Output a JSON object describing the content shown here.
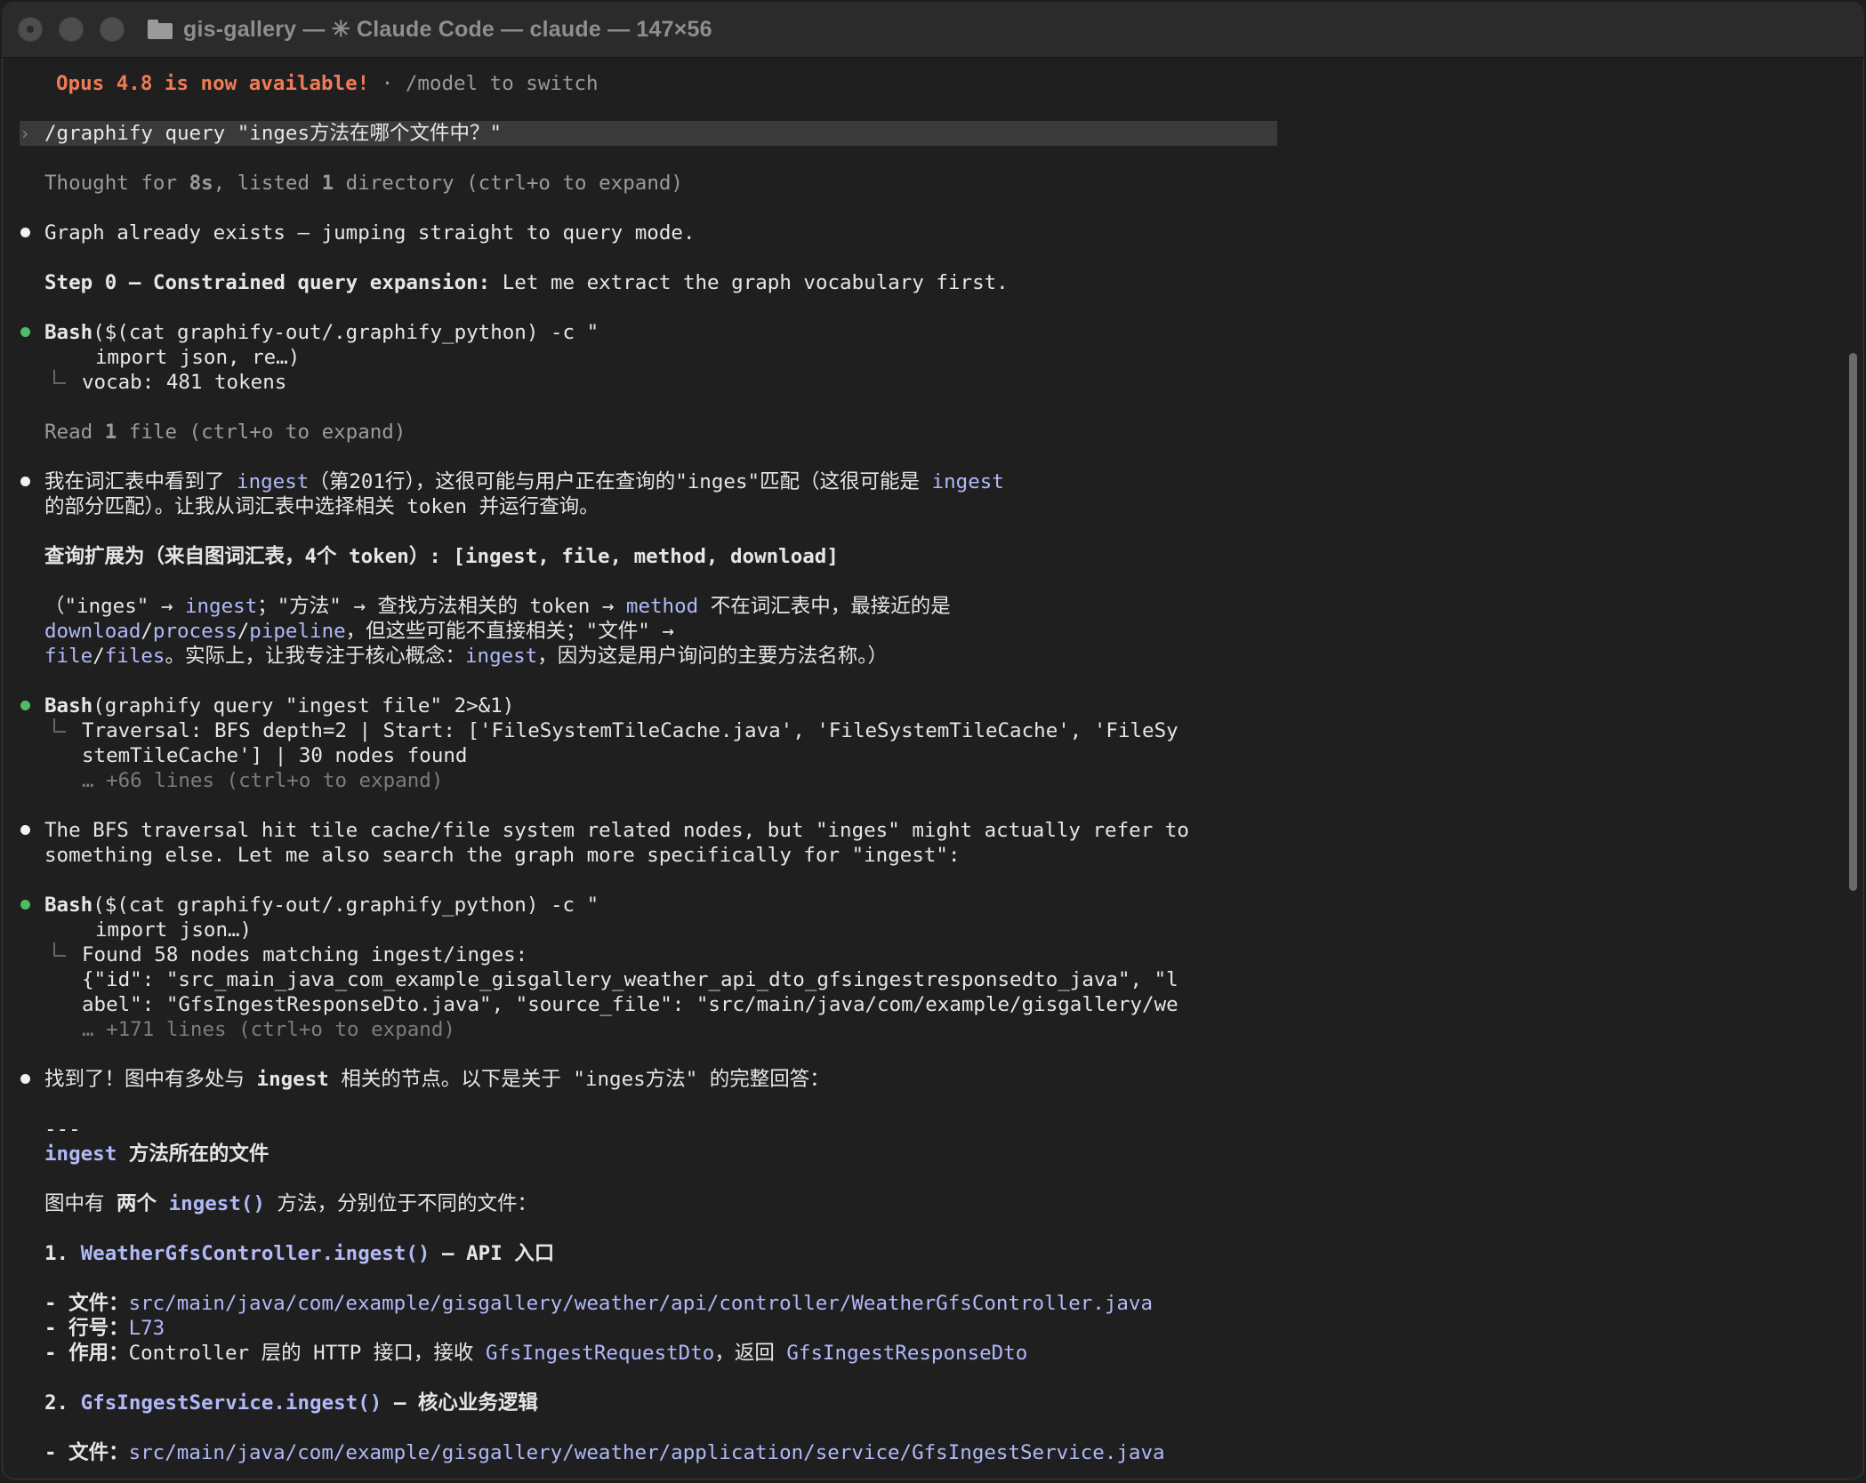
{
  "window": {
    "title": "gis-gallery — ✳ Claude Code — claude — 147×56"
  },
  "banner": {
    "highlight": "Opus 4.8 is now available!",
    "rest": " · /model to switch"
  },
  "prompt": {
    "chevron": "›",
    "text": "/graphify query \"inges方法在哪个文件中？\""
  },
  "thought": {
    "a": "Thought for ",
    "b": "8s",
    "c": ", listed ",
    "d": "1",
    "e": " directory (ctrl+o to expand)"
  },
  "msg1": "Graph already exists — jumping straight to query mode.",
  "step0": {
    "bold": "Step 0 — Constrained query expansion:",
    "rest": " Let me extract the graph vocabulary first."
  },
  "bash1": {
    "label": "Bash",
    "cmd": "($(cat graphify-out/.graphify_python) -c \"",
    "cont": "import json, re…)",
    "out": "vocab: 481 tokens"
  },
  "read": {
    "a": "Read ",
    "b": "1",
    "c": " file (ctrl+o to expand)"
  },
  "msg2": {
    "l1a": "我在词汇表中看到了 ",
    "l1b": "ingest",
    "l1c": "（第201行），这很可能与用户正在查询的\"inges\"匹配（这很可能是 ",
    "l1d": "ingest",
    "l2": "的部分匹配）。让我从词汇表中选择相关 token 并运行查询。"
  },
  "expand": "查询扩展为（来自图词汇表，4个 token）: [ingest, file, method, download]",
  "note": {
    "l1a": "（\"inges\" → ",
    "l1b": "ingest",
    "l1c": "；\"方法\" → 查找方法相关的 token → ",
    "l1d": "method",
    "l1e": " 不在词汇表中，最接近的是",
    "l2a": "download",
    "l2b": "/",
    "l2c": "process",
    "l2d": "/",
    "l2e": "pipeline",
    "l2f": "，但这些可能不直接相关；\"文件\" →",
    "l3a": "file",
    "l3b": "/",
    "l3c": "files",
    "l3d": "。实际上，让我专注于核心概念：",
    "l3e": "ingest",
    "l3f": "，因为这是用户询问的主要方法名称。）"
  },
  "bash2": {
    "label": "Bash",
    "cmd": "(graphify query \"ingest file\" 2>&1)",
    "out1": "Traversal: BFS depth=2 | Start: ['FileSystemTileCache.java', 'FileSystemTileCache', 'FileSy",
    "out2": "stemTileCache'] | 30 nodes found",
    "more": "… +66 lines (ctrl+o to expand)"
  },
  "msg3": {
    "l1": "The BFS traversal hit tile cache/file system related nodes, but \"inges\" might actually refer to",
    "l2": "something else. Let me also search the graph more specifically for \"ingest\":"
  },
  "bash3": {
    "label": "Bash",
    "cmd": "($(cat graphify-out/.graphify_python) -c \"",
    "cont": "import json…)",
    "out1": "Found 58 nodes matching ingest/inges:",
    "out2": "{\"id\": \"src_main_java_com_example_gisgallery_weather_api_dto_gfsingestresponsedto_java\", \"l",
    "out3": "abel\": \"GfsIngestResponseDto.java\", \"source_file\": \"src/main/java/com/example/gisgallery/we",
    "more": "… +171 lines (ctrl+o to expand)"
  },
  "msg4": {
    "a": "找到了！图中有多处与 ",
    "b": "ingest",
    "c": " 相关的节点。以下是关于 \"inges方法\" 的完整回答："
  },
  "answer": {
    "rule": "---",
    "heading_code": "ingest",
    "heading_rest": " 方法所在的文件",
    "intro_a": "图中有 ",
    "intro_b": "两个",
    "intro_c": " ",
    "intro_d": "ingest()",
    "intro_e": " 方法，分别位于不同的文件：",
    "item1": {
      "num": "1. ",
      "name": "WeatherGfsController.ingest()",
      "rest": " — API 入口",
      "file_label": "- 文件：",
      "file": "src/main/java/com/example/gisgallery/weather/api/controller/WeatherGfsController.java",
      "line_label": "- 行号：",
      "line": "L73",
      "use_label": "- 作用：",
      "use_a": "Controller 层的 HTTP 接口，接收 ",
      "use_b": "GfsIngestRequestDto",
      "use_c": "，返回 ",
      "use_d": "GfsIngestResponseDto"
    },
    "item2": {
      "num": "2. ",
      "name": "GfsIngestService.ingest()",
      "rest": " — 核心业务逻辑",
      "file_label": "- 文件：",
      "file": "src/main/java/com/example/gisgallery/weather/application/service/GfsIngestService.java"
    }
  }
}
